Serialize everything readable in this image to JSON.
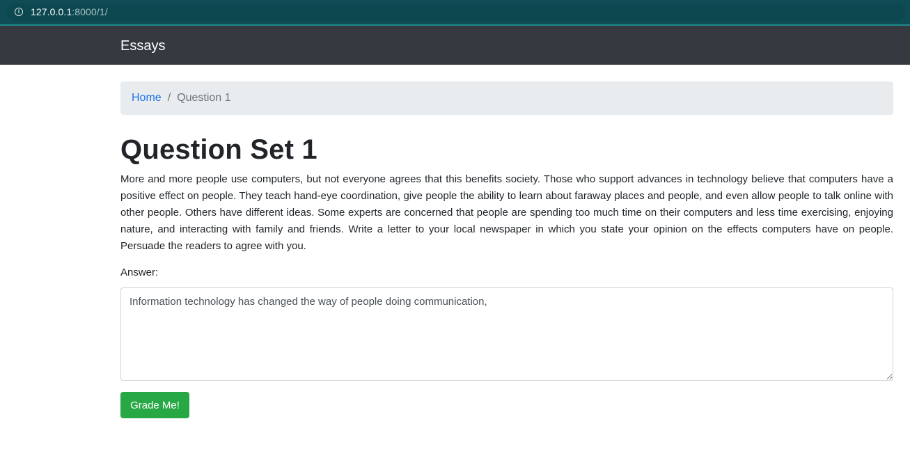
{
  "browser": {
    "url_host": "127.0.0.1",
    "url_rest": ":8000/1/",
    "info_icon": "info-icon"
  },
  "navbar": {
    "brand": "Essays"
  },
  "breadcrumb": {
    "home": "Home",
    "separator": "/",
    "current": "Question 1"
  },
  "page": {
    "title": "Question Set 1",
    "prompt": "More and more people use computers, but not everyone agrees that this benefits society. Those who support advances in technology believe that computers have a positive effect on people. They teach hand-eye coordination, give people the ability to learn about faraway places and people, and even allow people to talk online with other people. Others have different ideas. Some experts are concerned that people are spending too much time on their computers and less time exercising, enjoying nature, and interacting with family and friends. Write a letter to your local newspaper in which you state your opinion on the effects computers have on people. Persuade the readers to agree with you.",
    "answer_label": "Answer:",
    "answer_value": "Information technology has changed the way of people doing communication,",
    "submit_label": "Grade Me!"
  },
  "colors": {
    "navbar": "#343a40",
    "addressbar": "#0f4c55",
    "link": "#1a73e8",
    "button": "#28a745",
    "breadcrumb_bg": "#e9ecef"
  }
}
